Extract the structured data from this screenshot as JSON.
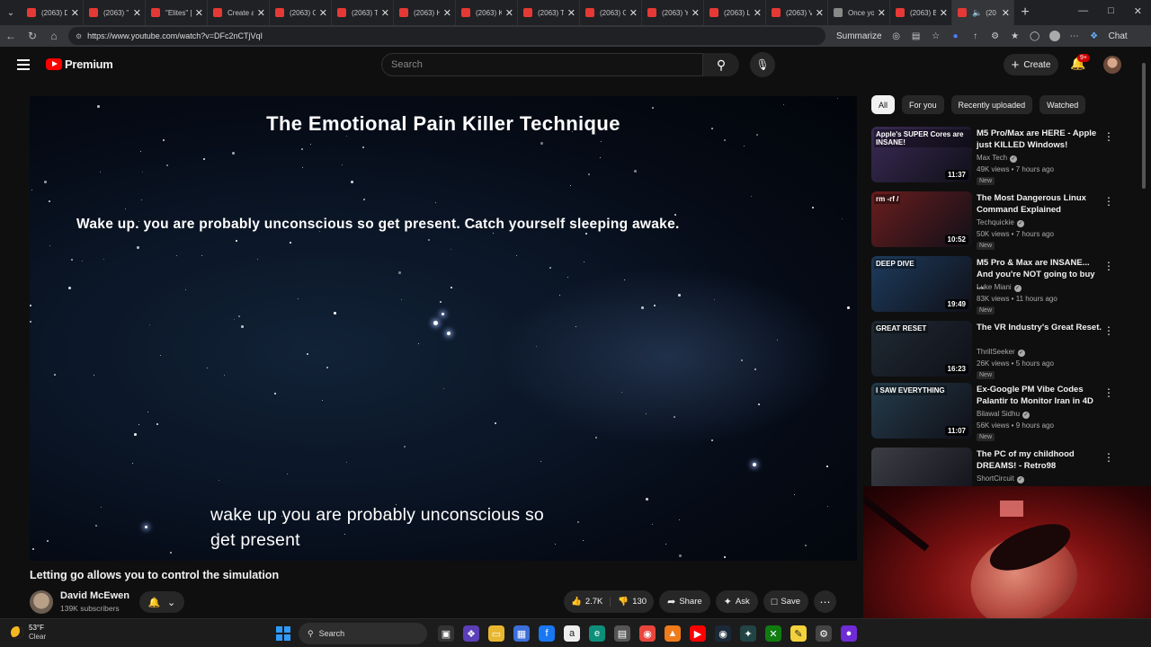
{
  "browser": {
    "tabs": [
      {
        "label": "(2063) D"
      },
      {
        "label": "(2063) \""
      },
      {
        "label": "\"Elites\" ["
      },
      {
        "label": "Create a"
      },
      {
        "label": "(2063) O"
      },
      {
        "label": "(2063) Th"
      },
      {
        "label": "(2063) H"
      },
      {
        "label": "(2063) K"
      },
      {
        "label": "(2063) Ta"
      },
      {
        "label": "(2063) O"
      },
      {
        "label": "(2063) Yo"
      },
      {
        "label": "(2063) Lo"
      },
      {
        "label": "(2063) V"
      },
      {
        "label": "Once yo"
      },
      {
        "label": "(2063) B"
      },
      {
        "label": "(20"
      }
    ],
    "url": "https://www.youtube.com/watch?v=DFc2nCTjVqI",
    "summarize_label": "Summarize",
    "chat_label": "Chat"
  },
  "youtube": {
    "logo_text": "Premium",
    "search_placeholder": "Search",
    "create_label": "Create",
    "notifications_badge": "9+"
  },
  "player": {
    "overlay_title": "The Emotional Pain Killer Technique",
    "overlay_line": "Wake up. you are probably unconscious so get present. Catch yourself sleeping awake.",
    "caption_line1": "wake up you are probably unconscious so",
    "caption_line2": "get present"
  },
  "video": {
    "title": "Letting go allows you to control the simulation",
    "channel": "David McEwen",
    "subscribers": "139K subscribers",
    "likes": "2.7K",
    "dislikes": "130",
    "share_label": "Share",
    "ask_label": "Ask",
    "save_label": "Save"
  },
  "chips": [
    "All",
    "For you",
    "Recently uploaded",
    "Watched"
  ],
  "recommendations": [
    {
      "thumb_text": "Apple's SUPER Cores are INSANE!",
      "duration": "11:37",
      "title": "M5 Pro/Max are HERE - Apple just KILLED Windows!",
      "channel": "Max Tech",
      "meta": "49K views • 7 hours ago",
      "badge": "New",
      "color": "#3a2a55"
    },
    {
      "thumb_text": "rm -rf /",
      "duration": "10:52",
      "title": "The Most Dangerous Linux Command Explained",
      "channel": "Techquickie",
      "meta": "50K views • 7 hours ago",
      "badge": "New",
      "color": "#6a1d1d"
    },
    {
      "thumb_text": "DEEP DIVE",
      "duration": "19:49",
      "title": "M5 Pro & Max are INSANE... And you're NOT going to buy ...",
      "channel": "Luke Miani",
      "meta": "83K views • 11 hours ago",
      "badge": "New",
      "color": "#1d3b5c"
    },
    {
      "thumb_text": "GREAT RESET",
      "duration": "16:23",
      "title": "The VR Industry's Great Reset.",
      "channel": "ThrillSeeker",
      "meta": "26K views • 5 hours ago",
      "badge": "New",
      "color": "#1f2a33"
    },
    {
      "thumb_text": "I SAW EVERYTHING",
      "duration": "11:07",
      "title": "Ex-Google PM Vibe Codes Palantir to Monitor Iran in 4D",
      "channel": "Bilawal Sidhu",
      "meta": "56K views • 9 hours ago",
      "badge": "New",
      "color": "#243b4a"
    },
    {
      "thumb_text": "",
      "duration": "",
      "title": "The PC of my childhood DREAMS! - Retro98",
      "channel": "ShortCircuit",
      "meta": "",
      "badge": "",
      "color": "#3d3d46"
    }
  ],
  "taskbar": {
    "temperature": "53°F",
    "condition": "Clear",
    "search_label": "Search"
  }
}
